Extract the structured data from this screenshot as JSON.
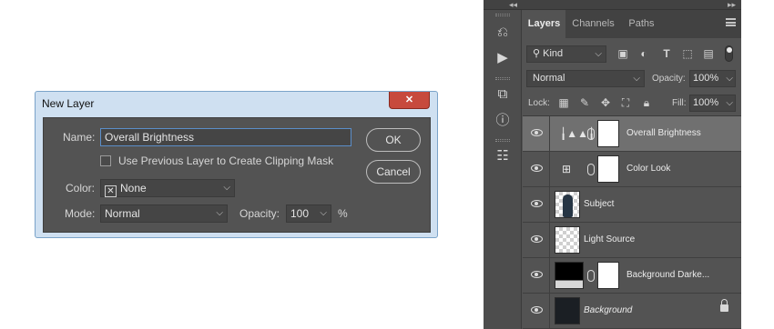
{
  "dialog": {
    "title": "New Layer",
    "close_label": "✕",
    "name_label": "Name:",
    "name_value": "Overall Brightness",
    "clip_label": "Use Previous Layer to Create Clipping Mask",
    "color_label": "Color:",
    "color_value": "None",
    "mode_label": "Mode:",
    "mode_value": "Normal",
    "opacity_label": "Opacity:",
    "opacity_value": "100",
    "opacity_unit": "%",
    "ok_label": "OK",
    "cancel_label": "Cancel"
  },
  "panel": {
    "collapse_left": "◂◂",
    "collapse_right": "▸▸",
    "tabs": [
      {
        "label": "Layers",
        "active": true
      },
      {
        "label": "Channels",
        "active": false
      },
      {
        "label": "Paths",
        "active": false
      }
    ],
    "filter_label": "Kind",
    "blend_mode": "Normal",
    "opacity_label": "Opacity:",
    "opacity_value": "100%",
    "lock_label": "Lock:",
    "fill_label": "Fill:",
    "fill_value": "100%",
    "layers": [
      {
        "name": "Overall Brightness",
        "kind": "levels-adjustment",
        "selected": true,
        "mask": true
      },
      {
        "name": "Color Look",
        "kind": "curves-adjustment",
        "selected": false,
        "mask": true
      },
      {
        "name": "Subject",
        "kind": "image",
        "selected": false,
        "mask": false
      },
      {
        "name": "Light Source",
        "kind": "transparent",
        "selected": false,
        "mask": false
      },
      {
        "name": "Background Darke...",
        "kind": "gradient-adjustment",
        "selected": false,
        "mask": true
      },
      {
        "name": "Background",
        "kind": "image",
        "selected": false,
        "mask": false,
        "locked": true
      }
    ]
  },
  "colors": {
    "panel_bg": "#535353",
    "dialog_frame": "#cfe0f1",
    "close_red": "#c74a3d",
    "focus_blue": "#5b8ec9",
    "selected_layer": "#707070"
  }
}
